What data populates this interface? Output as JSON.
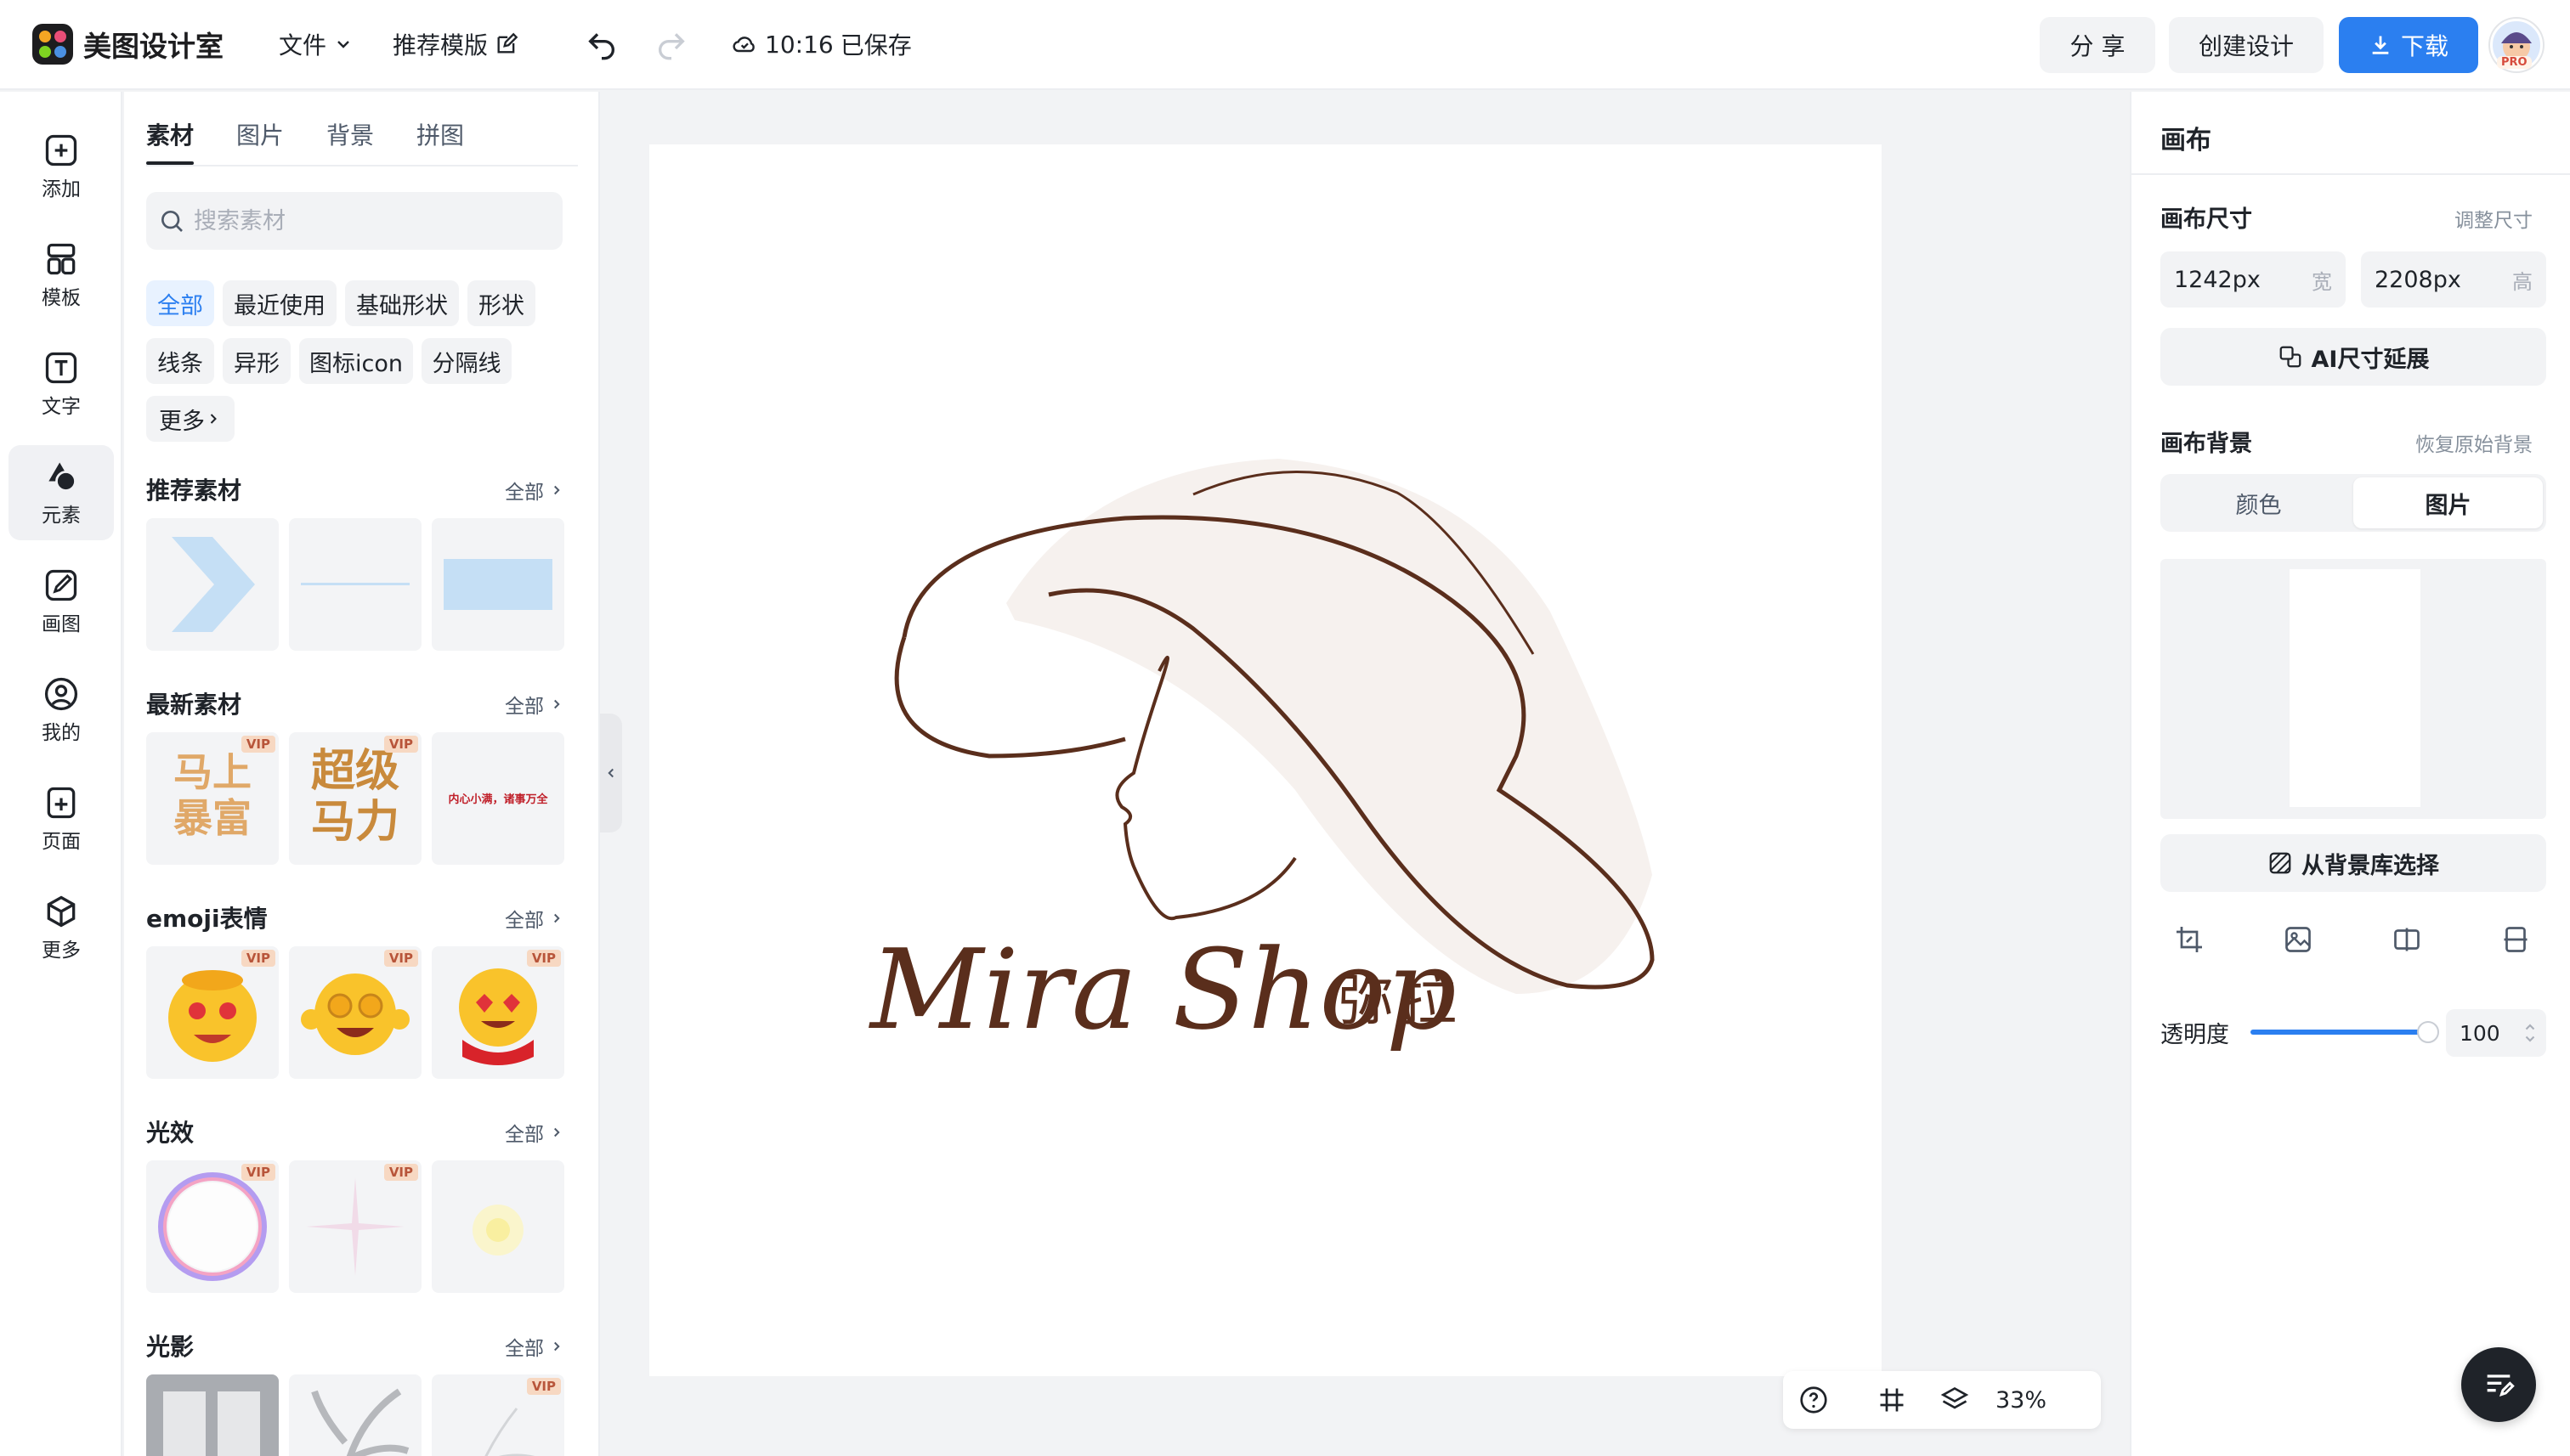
{
  "app": {
    "title": "美图设计室"
  },
  "topbar": {
    "file_menu": "文件",
    "recommend_template": "推荐模版",
    "saved_time": "10:16",
    "saved_status": "已保存",
    "share": "分 享",
    "create_design": "创建设计",
    "download": "下载",
    "avatar_badge": "PRO"
  },
  "leftnav": {
    "items": [
      {
        "label": "添加",
        "icon": "add-icon"
      },
      {
        "label": "模板",
        "icon": "template-icon"
      },
      {
        "label": "文字",
        "icon": "text-icon"
      },
      {
        "label": "元素",
        "icon": "elements-icon"
      },
      {
        "label": "画图",
        "icon": "draw-icon"
      },
      {
        "label": "我的",
        "icon": "user-icon"
      },
      {
        "label": "页面",
        "icon": "page-icon"
      },
      {
        "label": "更多",
        "icon": "more-cube-icon"
      }
    ],
    "active": "元素"
  },
  "panel": {
    "tabs": [
      "素材",
      "图片",
      "背景",
      "拼图"
    ],
    "active_tab": "素材",
    "search_placeholder": "搜索素材",
    "chips": [
      "全部",
      "最近使用",
      "基础形状",
      "形状",
      "线条",
      "异形",
      "图标icon",
      "分隔线",
      "更多"
    ],
    "active_chip": "全部",
    "sections": [
      {
        "title": "推荐素材",
        "all": "全部"
      },
      {
        "title": "最新素材",
        "all": "全部"
      },
      {
        "title": "emoji表情",
        "all": "全部"
      },
      {
        "title": "光效",
        "all": "全部"
      },
      {
        "title": "光影",
        "all": "全部"
      }
    ],
    "vip_badge": "VIP",
    "new_tiles": {
      "t1": "马上\n暴富",
      "t2": "超级\n马力",
      "t3": "内心小满，诸事万全"
    }
  },
  "canvas": {
    "logo_script": "Mira Shop",
    "logo_cn": "弥拉"
  },
  "bottombar": {
    "zoom": "33%"
  },
  "rpanel": {
    "title": "画布",
    "size_label": "画布尺寸",
    "resize_link": "调整尺寸",
    "width_value": "1242px",
    "width_unit": "宽",
    "height_value": "2208px",
    "height_unit": "高",
    "ai_extend": "AI尺寸延展",
    "bg_label": "画布背景",
    "restore_bg": "恢复原始背景",
    "seg_color": "颜色",
    "seg_image": "图片",
    "from_library": "从背景库选择",
    "opacity_label": "透明度",
    "opacity_value": "100"
  },
  "colors": {
    "accent": "#2b7ff0",
    "logo_brown": "#5a2e1c",
    "hat_fill": "#f6f1ee"
  }
}
